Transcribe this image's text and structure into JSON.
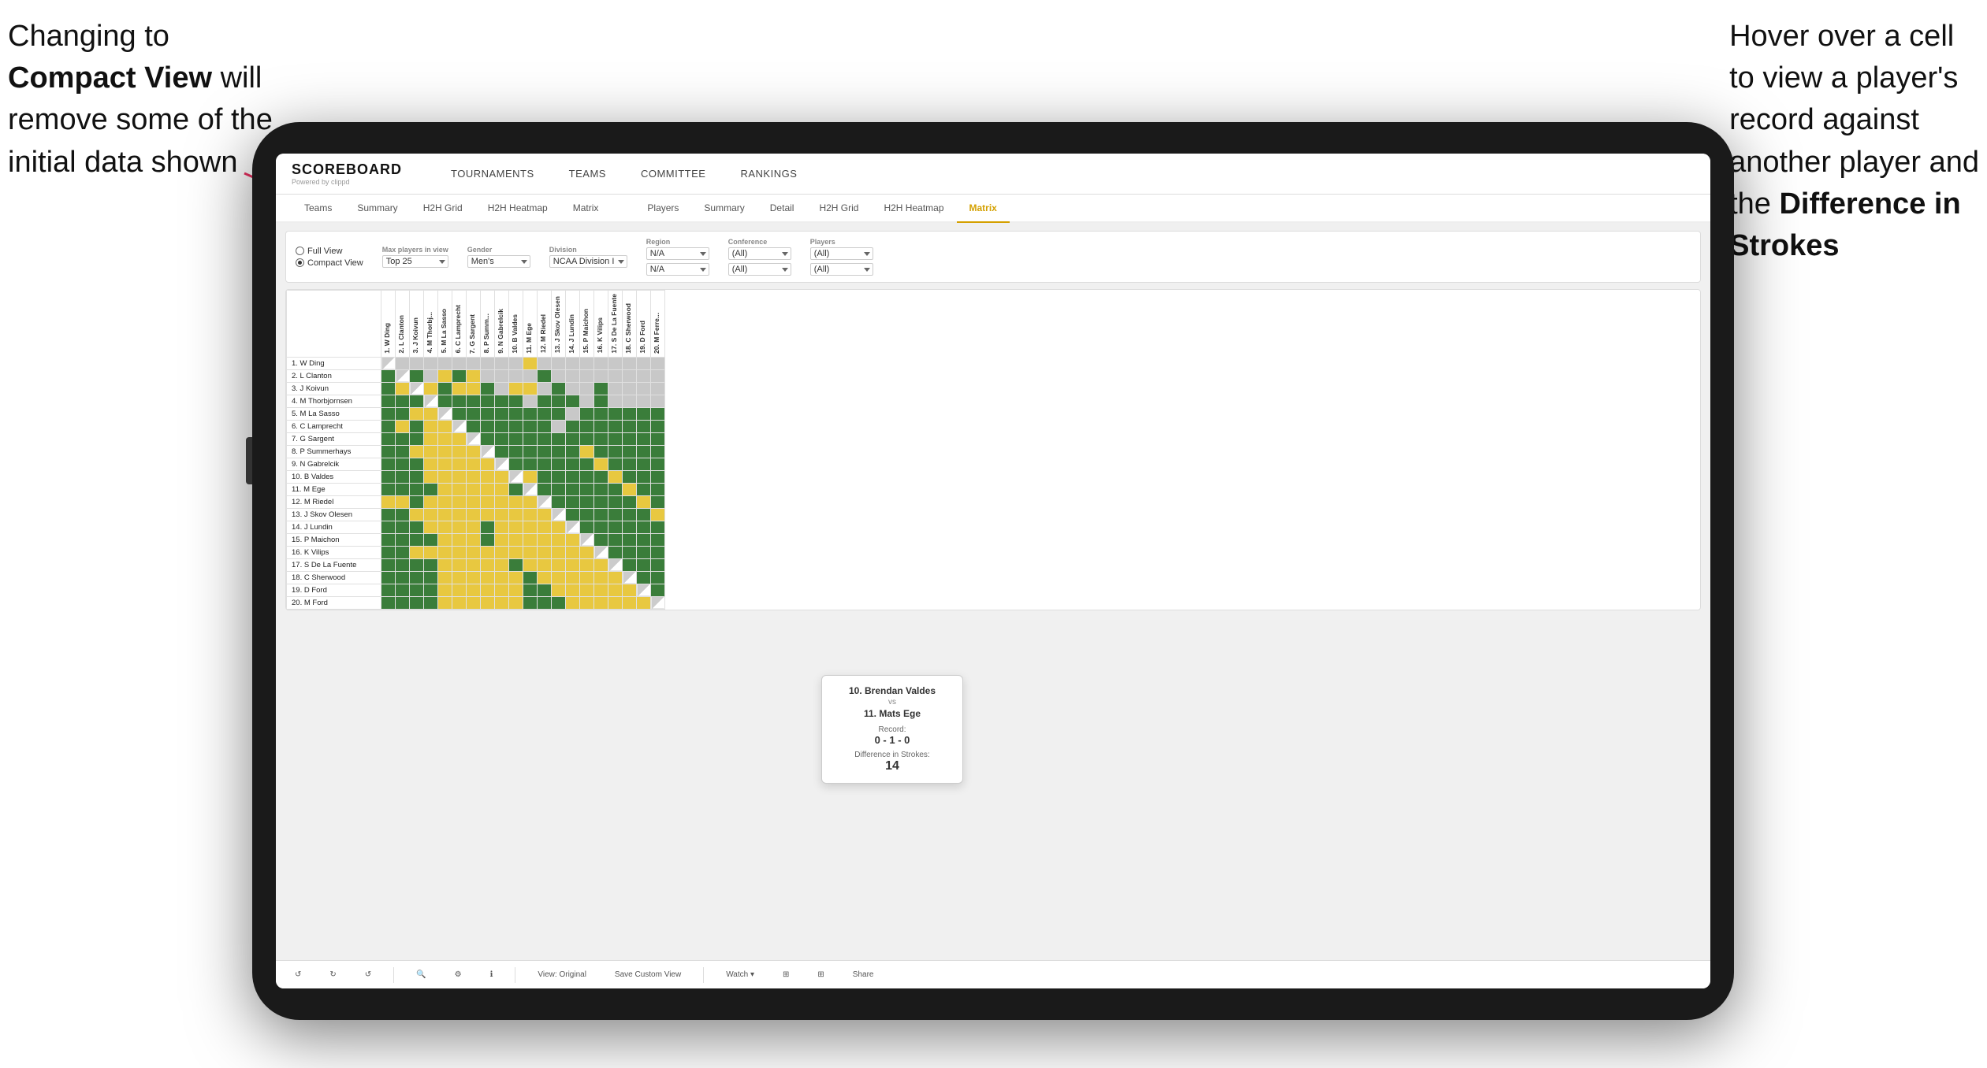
{
  "annotations": {
    "left": {
      "line1": "Changing to",
      "line2_bold": "Compact View",
      "line2_rest": " will",
      "line3": "remove some of the",
      "line4": "initial data shown"
    },
    "right": {
      "line1": "Hover over a cell",
      "line2": "to view a player's",
      "line3": "record against",
      "line4": "another player and",
      "line5_pre": "the ",
      "line5_bold": "Difference in",
      "line6_bold": "Strokes"
    }
  },
  "app": {
    "logo": "SCOREBOARD",
    "logo_sub": "Powered by clippd",
    "nav": [
      "TOURNAMENTS",
      "TEAMS",
      "COMMITTEE",
      "RANKINGS"
    ]
  },
  "tabs_row1": [
    "Teams",
    "Summary",
    "H2H Grid",
    "H2H Heatmap",
    "Matrix"
  ],
  "tabs_row2": [
    "Players",
    "Summary",
    "Detail",
    "H2H Grid",
    "H2H Heatmap",
    "Matrix"
  ],
  "active_tab": "Matrix",
  "filters": {
    "view_options": [
      "Full View",
      "Compact View"
    ],
    "selected_view": "Compact View",
    "max_players_label": "Max players in view",
    "max_players_value": "Top 25",
    "gender_label": "Gender",
    "gender_value": "Men's",
    "division_label": "Division",
    "division_value": "NCAA Division I",
    "region_label": "Region",
    "region_values": [
      "N/A",
      "N/A"
    ],
    "conference_label": "Conference",
    "conference_values": [
      "(All)",
      "(All)"
    ],
    "players_label": "Players",
    "players_values": [
      "(All)",
      "(All)"
    ]
  },
  "players": [
    "1. W Ding",
    "2. L Clanton",
    "3. J Koivun",
    "4. M Thorbjornsen",
    "5. M La Sasso",
    "6. C Lamprecht",
    "7. G Sargent",
    "8. P Summerhays",
    "9. N Gabrelcik",
    "10. B Valdes",
    "11. M Ege",
    "12. M Riedel",
    "13. J Skov Olesen",
    "14. J Lundin",
    "15. P Maichon",
    "16. K Vilips",
    "17. S De La Fuente",
    "18. C Sherwood",
    "19. D Ford",
    "20. M Ford"
  ],
  "col_headers": [
    "1. W Ding",
    "2. L Clanton",
    "3. J Koivun",
    "4. M Thorbj...",
    "5. M La Sasso",
    "6. C Lamprecht",
    "7. G Sargent",
    "8. P Summ...",
    "9. N Gabrelcik",
    "10. B Valdes",
    "11. M Ege",
    "12. M Riedel",
    "13. J Skov Olesen",
    "14. J Lundin",
    "15. P Maichon",
    "16. K Vilips",
    "17. S De La Fuente",
    "18. C Sherwood",
    "19. D Ford",
    "20. M Ferre..."
  ],
  "tooltip": {
    "player1": "10. Brendan Valdes",
    "vs": "vs",
    "player2": "11. Mats Ege",
    "record_label": "Record:",
    "record": "0 - 1 - 0",
    "diff_label": "Difference in Strokes:",
    "diff": "14"
  },
  "toolbar": {
    "undo": "↺",
    "view_original": "View: Original",
    "save_custom": "Save Custom View",
    "watch": "Watch ▾",
    "share": "Share"
  }
}
